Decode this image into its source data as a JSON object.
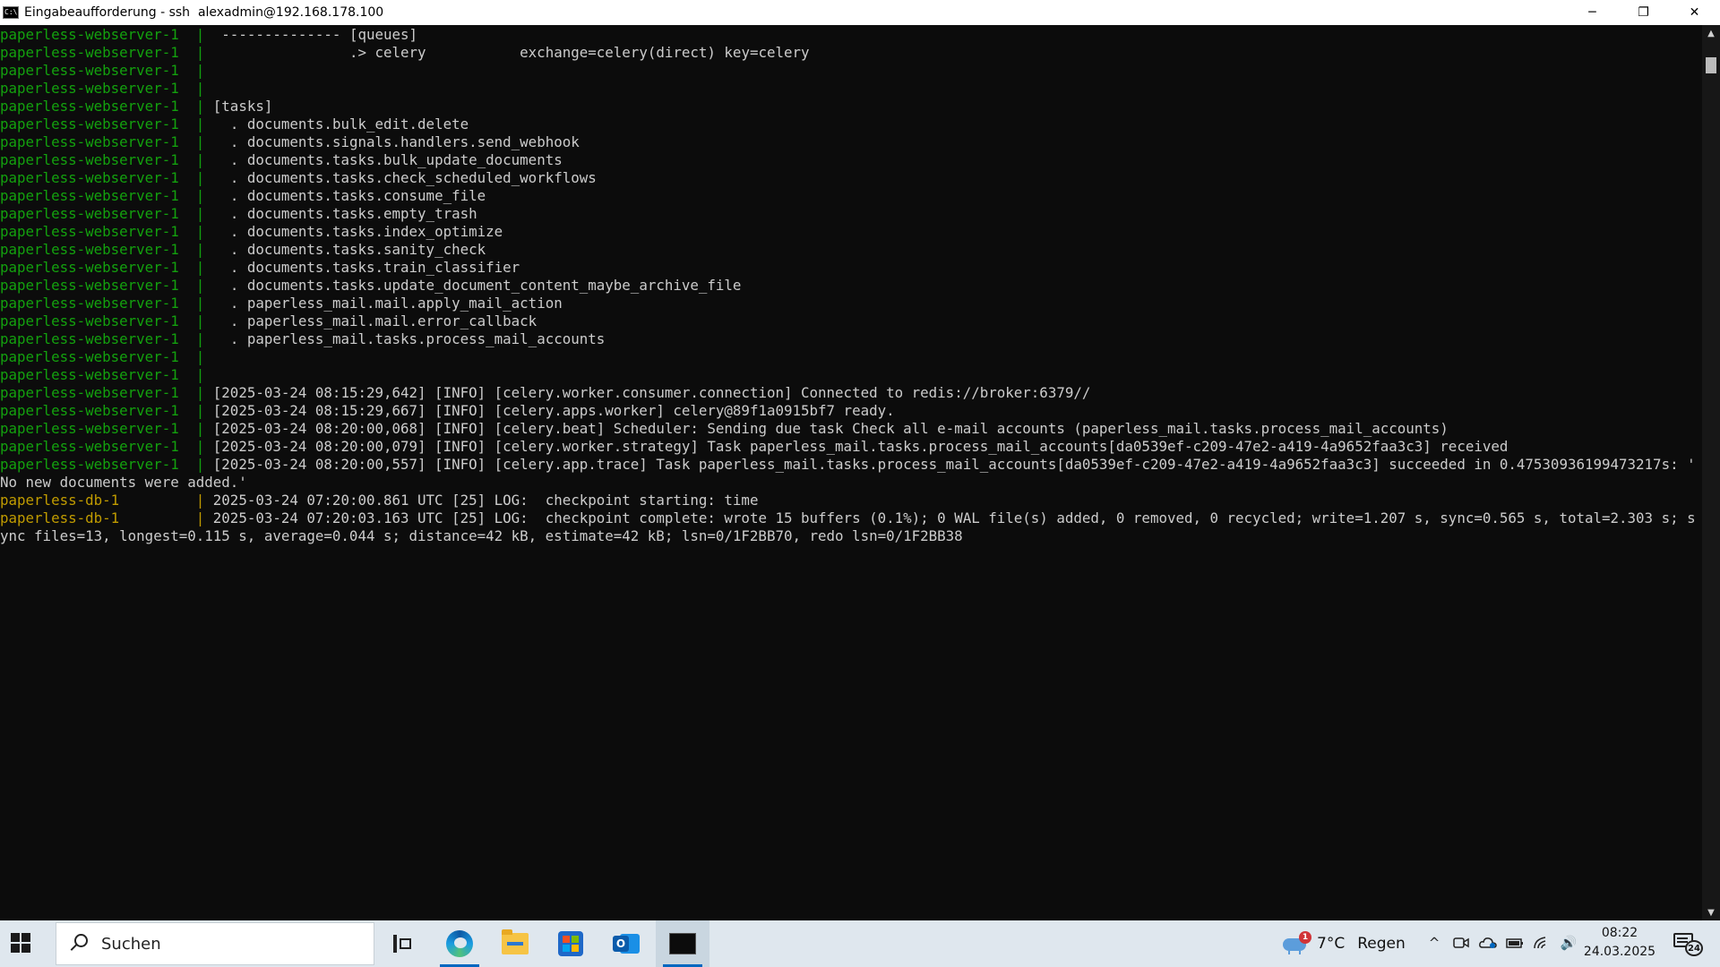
{
  "window": {
    "icon_text": "C:\\",
    "title": "Eingabeaufforderung - ssh  alexadmin@192.168.178.100",
    "controls": {
      "minimize": "─",
      "restore": "❐",
      "close": "✕"
    }
  },
  "terminal": {
    "lines": [
      {
        "service": "paperless-webserver-1",
        "type": "web",
        "sep": "  |  ",
        "text": "-------------- [queues]"
      },
      {
        "service": "paperless-webserver-1",
        "type": "web",
        "sep": "  |  ",
        "text": "               .> celery           exchange=celery(direct) key=celery"
      },
      {
        "service": "paperless-webserver-1",
        "type": "web",
        "sep": "  |",
        "text": ""
      },
      {
        "service": "paperless-webserver-1",
        "type": "web",
        "sep": "  |",
        "text": ""
      },
      {
        "service": "paperless-webserver-1",
        "type": "web",
        "sep": "  | ",
        "text": "[tasks]"
      },
      {
        "service": "paperless-webserver-1",
        "type": "web",
        "sep": "  |   ",
        "text": ". documents.bulk_edit.delete"
      },
      {
        "service": "paperless-webserver-1",
        "type": "web",
        "sep": "  |   ",
        "text": ". documents.signals.handlers.send_webhook"
      },
      {
        "service": "paperless-webserver-1",
        "type": "web",
        "sep": "  |   ",
        "text": ". documents.tasks.bulk_update_documents"
      },
      {
        "service": "paperless-webserver-1",
        "type": "web",
        "sep": "  |   ",
        "text": ". documents.tasks.check_scheduled_workflows"
      },
      {
        "service": "paperless-webserver-1",
        "type": "web",
        "sep": "  |   ",
        "text": ". documents.tasks.consume_file"
      },
      {
        "service": "paperless-webserver-1",
        "type": "web",
        "sep": "  |   ",
        "text": ". documents.tasks.empty_trash"
      },
      {
        "service": "paperless-webserver-1",
        "type": "web",
        "sep": "  |   ",
        "text": ". documents.tasks.index_optimize"
      },
      {
        "service": "paperless-webserver-1",
        "type": "web",
        "sep": "  |   ",
        "text": ". documents.tasks.sanity_check"
      },
      {
        "service": "paperless-webserver-1",
        "type": "web",
        "sep": "  |   ",
        "text": ". documents.tasks.train_classifier"
      },
      {
        "service": "paperless-webserver-1",
        "type": "web",
        "sep": "  |   ",
        "text": ". documents.tasks.update_document_content_maybe_archive_file"
      },
      {
        "service": "paperless-webserver-1",
        "type": "web",
        "sep": "  |   ",
        "text": ". paperless_mail.mail.apply_mail_action"
      },
      {
        "service": "paperless-webserver-1",
        "type": "web",
        "sep": "  |   ",
        "text": ". paperless_mail.mail.error_callback"
      },
      {
        "service": "paperless-webserver-1",
        "type": "web",
        "sep": "  |   ",
        "text": ". paperless_mail.tasks.process_mail_accounts"
      },
      {
        "service": "paperless-webserver-1",
        "type": "web",
        "sep": "  |",
        "text": ""
      },
      {
        "service": "paperless-webserver-1",
        "type": "web",
        "sep": "  |",
        "text": ""
      },
      {
        "service": "paperless-webserver-1",
        "type": "web",
        "sep": "  | ",
        "text": "[2025-03-24 08:15:29,642] [INFO] [celery.worker.consumer.connection] Connected to redis://broker:6379//"
      },
      {
        "service": "paperless-webserver-1",
        "type": "web",
        "sep": "  | ",
        "text": "[2025-03-24 08:15:29,667] [INFO] [celery.apps.worker] celery@89f1a0915bf7 ready."
      },
      {
        "service": "paperless-webserver-1",
        "type": "web",
        "sep": "  | ",
        "text": "[2025-03-24 08:20:00,068] [INFO] [celery.beat] Scheduler: Sending due task Check all e-mail accounts (paperless_mail.tasks.process_mail_accounts)"
      },
      {
        "service": "paperless-webserver-1",
        "type": "web",
        "sep": "  | ",
        "text": "[2025-03-24 08:20:00,079] [INFO] [celery.worker.strategy] Task paperless_mail.tasks.process_mail_accounts[da0539ef-c209-47e2-a419-4a9652faa3c3] received"
      },
      {
        "service": "paperless-webserver-1",
        "type": "web",
        "sep": "  | ",
        "text": "[2025-03-24 08:20:00,557] [INFO] [celery.app.trace] Task paperless_mail.tasks.process_mail_accounts[da0539ef-c209-47e2-a419-4a9652faa3c3] succeeded in 0.47530936199473217s: '"
      },
      {
        "service": "",
        "type": "plain",
        "sep": "",
        "text": "No new documents were added.'"
      },
      {
        "service": "paperless-db-1",
        "type": "db",
        "sep": "         | ",
        "text": "2025-03-24 07:20:00.861 UTC [25] LOG:  checkpoint starting: time"
      },
      {
        "service": "paperless-db-1",
        "type": "db",
        "sep": "         | ",
        "text": "2025-03-24 07:20:03.163 UTC [25] LOG:  checkpoint complete: wrote 15 buffers (0.1%); 0 WAL file(s) added, 0 removed, 0 recycled; write=1.207 s, sync=0.565 s, total=2.303 s; s"
      },
      {
        "service": "",
        "type": "plain",
        "sep": "",
        "text": "ync files=13, longest=0.115 s, average=0.044 s; distance=42 kB, estimate=42 kB; lsn=0/1F2BB70, redo lsn=0/1F2BB38"
      }
    ]
  },
  "scrollbar": {
    "up": "▲",
    "down": "▼"
  },
  "taskbar": {
    "search_placeholder": "Suchen",
    "weather": {
      "temp": "7°C",
      "condition": "Regen",
      "badge": "1"
    },
    "tray": {
      "chevron": "^",
      "volume": "🔊"
    },
    "clock": {
      "time": "08:22",
      "date": "24.03.2025"
    },
    "notifications": {
      "count": "24"
    },
    "colors": {
      "store_tiles": [
        "#f25022",
        "#7fba00",
        "#00a4ef",
        "#ffb900"
      ]
    }
  }
}
